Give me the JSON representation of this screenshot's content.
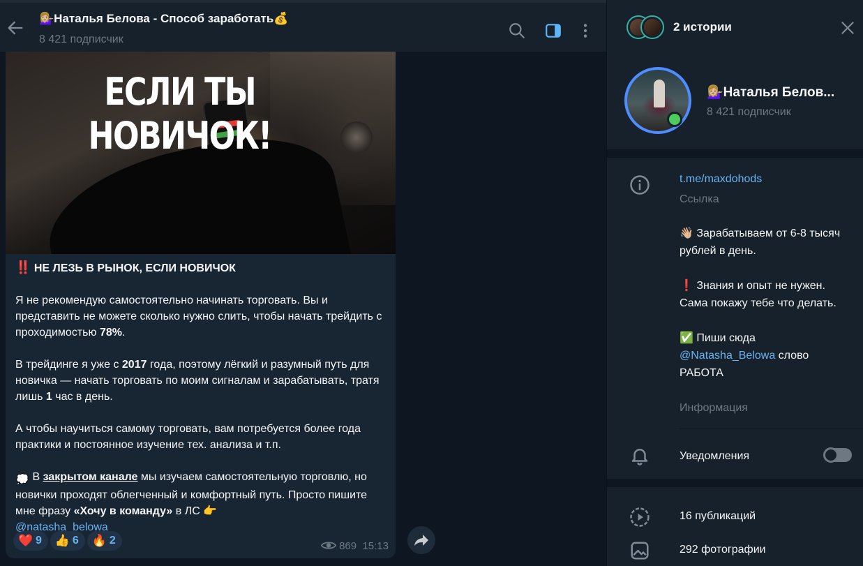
{
  "header": {
    "title_emoji": "💁🏼‍♀️",
    "title": "Наталья Белова - Способ заработать",
    "title_suffix_emoji": "💰",
    "subscribers": "8 421 подписчик",
    "back_icon": "arrow-left-icon",
    "search_icon": "search-icon",
    "panel_icon": "sidebar-toggle-icon",
    "more_icon": "more-vertical-icon"
  },
  "post": {
    "image_caption": "ЕСЛИ ТЫ НОВИЧОК!",
    "headline_emoji": "‼️",
    "headline": "НЕ ЛЕЗЬ В РЫНОК, ЕСЛИ НОВИЧОК",
    "p1_a": "Я не рекомендую самостоятельно начинать торговать. Вы и представить не можете сколько нужно слить, чтобы начать трейдить с проходимостью ",
    "p1_b": "78%",
    "p1_c": ".",
    "p2_a": "В трейдинге я уже с ",
    "p2_b": "2017",
    "p2_c": " года, поэтому лёгкий и разумный путь для новичка — начать торговать по моим сигналам и зарабатывать, тратя лишь ",
    "p2_d": "1",
    "p2_e": " час в день.",
    "p3": "А чтобы научиться самому торговать, вам потребуется более года практики и постоянное изучение тех. анализа и т.п.",
    "p4_emoji": "💭",
    "p4_a": " В ",
    "p4_link": "закрытом канале",
    "p4_b": " мы изучаем самостоятельную торговлю, но новички проходят облегченный и комфортный путь. Просто пишите мне фразу ",
    "p4_quote": "«Хочу в команду»",
    "p4_c": " в ЛС ",
    "p4_hand": "👉",
    "p4_mention": "@natasha_belowa",
    "reactions": [
      {
        "emoji": "❤️",
        "count": "9"
      },
      {
        "emoji": "👍",
        "count": "6"
      },
      {
        "emoji": "🔥",
        "count": "2"
      }
    ],
    "views_icon": "eye-icon",
    "views": "869",
    "time": "15:13",
    "share_icon": "share-arrow-icon"
  },
  "info_panel": {
    "stories_label": "2 истории",
    "close_icon": "close-icon",
    "profile_name": "💁🏼‍♀️Наталья Белов...",
    "profile_sub": "8 421 подписчик",
    "link": "t.me/maxdohods",
    "link_caption": "Ссылка",
    "about_1_emoji": "👋🏼",
    "about_1": " Зарабатываем от 6-8 тысяч рублей в день.",
    "about_2_emoji": "❗",
    "about_2": " Знания и опыт не нужен. Сама покажу тебе что делать.",
    "about_3_emoji": "✅",
    "about_3_a": " Пиши сюда ",
    "about_3_mention": "@Natasha_Belowa",
    "about_3_b": " слово РАБОТА",
    "about_caption": "Информация",
    "notifications_label": "Уведомления",
    "notifications_on": false,
    "publications": "16 публикаций",
    "photos": "292 фотографии"
  },
  "colors": {
    "background": "#0e1621",
    "panel": "#17212b",
    "bubble": "#182533",
    "accent": "#6ab2f2",
    "muted": "#6d7883",
    "online": "#4dcd5e"
  }
}
